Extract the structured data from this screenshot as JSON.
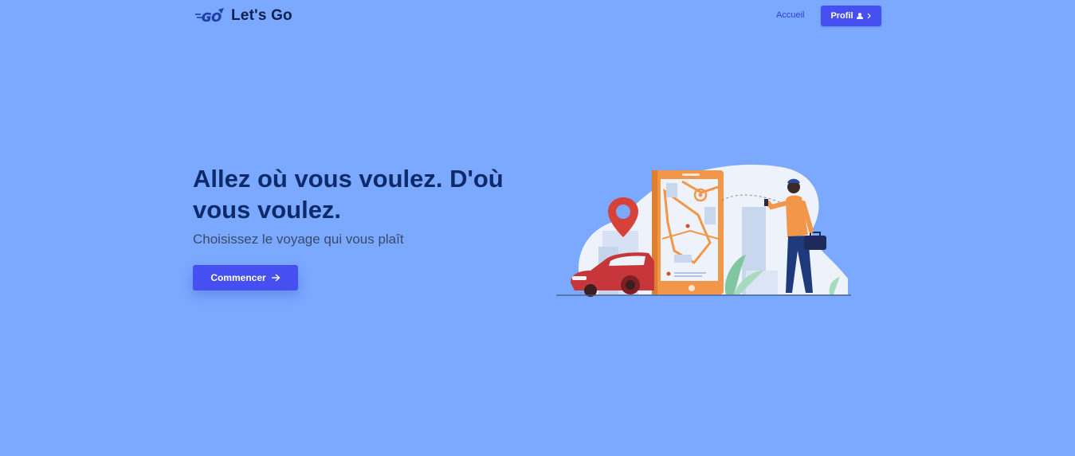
{
  "nav": {
    "brand_name": "Let's Go",
    "logo_text": "GO",
    "home_link": "Accueil",
    "profile_button": "Profil"
  },
  "hero": {
    "title": "Allez où vous voulez. D'où vous voulez.",
    "subtitle": "Choisissez le voyage qui vous plaît",
    "cta_label": "Commencer"
  },
  "icons": {
    "logo": "go-logo-icon",
    "profile_user": "user-icon",
    "profile_chevron": "chevron-right-icon",
    "cta_arrow": "arrow-right-icon"
  },
  "colors": {
    "background": "#7aa9ff",
    "primary": "#4650f2",
    "title": "#0f2a6b",
    "brand_text": "#0f1f4f",
    "link": "#2d3fd6"
  }
}
